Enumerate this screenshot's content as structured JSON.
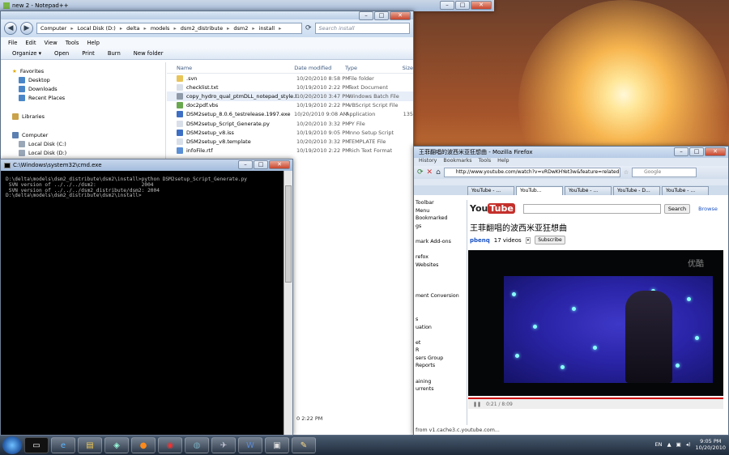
{
  "notepad": {
    "title": "new  2 - Notepad++"
  },
  "explorer": {
    "breadcrumb": [
      "Computer",
      "Local Disk (D:)",
      "delta",
      "models",
      "dsm2_distribute",
      "dsm2",
      "install"
    ],
    "search_placeholder": "Search install",
    "menu": [
      "File",
      "Edit",
      "View",
      "Tools",
      "Help"
    ],
    "commands": [
      "Organize ▾",
      "Open",
      "Print",
      "Burn",
      "New folder"
    ],
    "nav": {
      "favorites": "Favorites",
      "desktop": "Desktop",
      "downloads": "Downloads",
      "recent": "Recent Places",
      "libraries": "Libraries",
      "computer": "Computer",
      "local_c": "Local Disk (C:)",
      "local_d": "Local Disk (D:)"
    },
    "columns": [
      "Name",
      "Date modified",
      "Type",
      "Size"
    ],
    "files": [
      {
        "name": ".svn",
        "date": "10/20/2010 8:58 PM",
        "type": "File folder",
        "color": "#e8c45a"
      },
      {
        "name": "checklist.txt",
        "date": "10/19/2010 2:22 PM",
        "type": "Text Document",
        "color": "#d9dfe8"
      },
      {
        "name": "copy_hydro_qual_ptmDLL_notepad_style.bat",
        "date": "10/20/2010 3:47 PM",
        "type": "Windows Batch File",
        "color": "#8e9aa8"
      },
      {
        "name": "doc2pdf.vbs",
        "date": "10/19/2010 2:22 PM",
        "type": "VBScript Script File",
        "color": "#6aa84f"
      },
      {
        "name": "DSM2setup_8.0.6_testrelease.1997.exe",
        "date": "10/20/2010 9:08 AM",
        "type": "Application",
        "color": "#3d6fc4"
      },
      {
        "name": "DSM2setup_Script_Generate.py",
        "date": "10/20/2010 3:32 PM",
        "type": "PY File",
        "color": "#d9dfe8"
      },
      {
        "name": "DSM2setup_v8.iss",
        "date": "10/19/2010 9:05 PM",
        "type": "Inno Setup Script",
        "color": "#3d6fc4"
      },
      {
        "name": "DSM2setup_v8.template",
        "date": "10/20/2010 3:32 PM",
        "type": "TEMPLATE File",
        "color": "#d9dfe8"
      },
      {
        "name": "infoFile.rtf",
        "date": "10/19/2010 2:22 PM",
        "type": "Rich Text Format",
        "color": "#5b8fd6"
      }
    ],
    "size_partial": "135",
    "status_date": "0 2:22 PM"
  },
  "firefox": {
    "title": "王菲翻唱的波西米亚狂想曲 - Mozilla Firefox",
    "menu_partial": [
      "History",
      "Bookmarks",
      "Tools",
      "Help"
    ],
    "url": "http://www.youtube.com/watch?v=vRDwKHYet3w&feature=related",
    "search_placeholder": "Google",
    "tabs": [
      "YouTube - ...",
      "YouTub...",
      "YouTube - ...",
      "YouTube - D...",
      "YouTube - ..."
    ],
    "sidebar": [
      "Toolbar",
      "Menu",
      "Bookmarked",
      "gs",
      "",
      "mark Add-ons",
      "",
      "refox",
      "Websites",
      "",
      "",
      "",
      "ment Conversion",
      "",
      "",
      "s",
      "uation",
      "",
      "et",
      "R",
      "sers Group",
      "Reports",
      "",
      "aining",
      "urrents"
    ],
    "yt": {
      "logo": "YouTube",
      "search_button": "Search",
      "browse": "Browse",
      "video_title": "王菲翻唱的波西米亚狂想曲",
      "channel": "pbenq",
      "videos": "17 videos",
      "subscribe": "Subscribe",
      "watermark": "优酷",
      "time": "0:21 / 8:09"
    },
    "status": "from v1.cache3.c.youtube.com..."
  },
  "cmd": {
    "title": "C:\\Windows\\system32\\cmd.exe",
    "lines": [
      "D:\\delta\\models\\dsm2_distribute\\dsm2\\install>python DSM2setup_Script_Generate.py",
      " SVN version of ../../../dsm2:               2004",
      " SVN version of ../../../dsm2_distribute/dsm2: 2004",
      "",
      "D:\\delta\\models\\dsm2_distribute\\dsm2\\install>"
    ]
  },
  "taskbar": {
    "lang": "EN",
    "time": "9:05 PM",
    "date": "10/20/2010"
  }
}
